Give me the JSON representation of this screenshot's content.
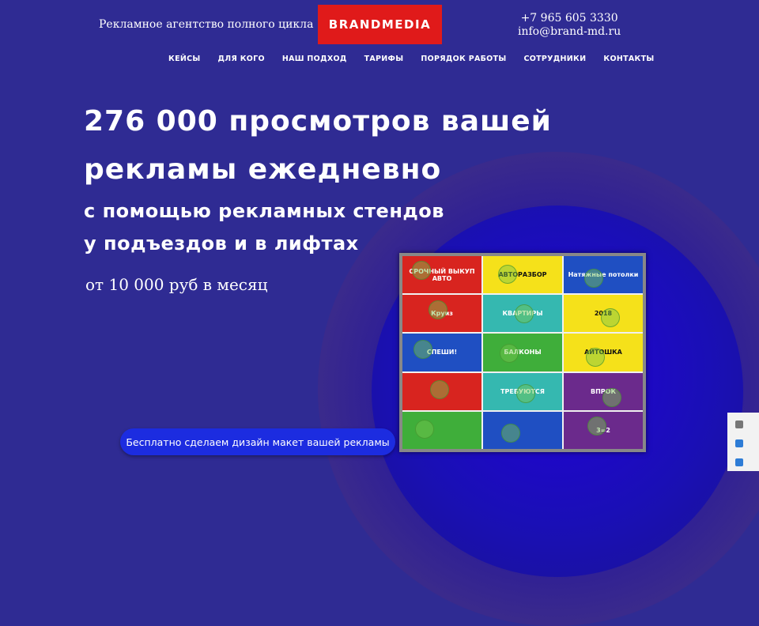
{
  "header": {
    "tagline": "Рекламное агентство полного цикла",
    "logo": "BRANDMEDIA",
    "phone": "+7 965 605 3330",
    "email": "info@brand-md.ru"
  },
  "nav": [
    "КЕЙСЫ",
    "ДЛЯ КОГО",
    "НАШ ПОДХОД",
    "ТАРИФЫ",
    "ПОРЯДОК РАБОТЫ",
    "СОТРУДНИКИ",
    "КОНТАКТЫ"
  ],
  "hero": {
    "line1": "276 000 просмотров вашей",
    "line2": "рекламы ежедневно",
    "line3": "с помощью рекламных стендов",
    "line4": "у подъездов и в лифтах",
    "price": "от 10 000 руб в месяц",
    "cta": "Бесплатно сделаем дизайн макет вашей рекламы"
  },
  "board": {
    "ads": [
      "СРОЧНЫЙ ВЫКУП АВТО",
      "АВТОРАЗБОР",
      "Натяжные потолки",
      "Круиз",
      "КВАРТИРЫ",
      "2018",
      "СПЕШИ!",
      "БАЛКОНЫ",
      "АЙТОШКА",
      "",
      "ТРЕБУЮТСЯ",
      "ВПРОК",
      "",
      "",
      "3=2"
    ],
    "colors": {
      "yellow": "#f5e11a",
      "red": "#d8241f",
      "blue": "#1f4fc2",
      "green": "#3fae3a",
      "teal": "#35b8b0",
      "purple": "#6b2a8c"
    }
  }
}
